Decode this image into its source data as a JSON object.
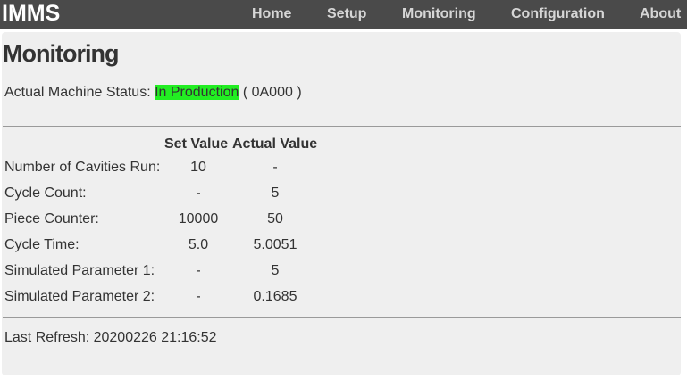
{
  "nav": {
    "brand": "IMMS",
    "links": [
      "Home",
      "Setup",
      "Monitoring",
      "Configuration",
      "About"
    ]
  },
  "page": {
    "title": "Monitoring",
    "status_label": "Actual Machine Status:",
    "status_value": "In Production",
    "status_code": "( 0A000 )",
    "status_color": "#22ee22"
  },
  "table": {
    "headers": {
      "set": "Set Value",
      "actual": "Actual Value"
    },
    "rows": [
      {
        "label": "Number of Cavities Run:",
        "set": "10",
        "actual": "-"
      },
      {
        "label": "Cycle Count:",
        "set": "-",
        "actual": "5"
      },
      {
        "label": "Piece Counter:",
        "set": "10000",
        "actual": "50"
      },
      {
        "label": "Cycle Time:",
        "set": "5.0",
        "actual": "5.0051"
      },
      {
        "label": "Simulated Parameter 1:",
        "set": "-",
        "actual": "5"
      },
      {
        "label": "Simulated Parameter 2:",
        "set": "-",
        "actual": "0.1685"
      }
    ]
  },
  "footer": {
    "refresh_label": "Last Refresh:",
    "refresh_value": "20200226 21:16:52"
  }
}
